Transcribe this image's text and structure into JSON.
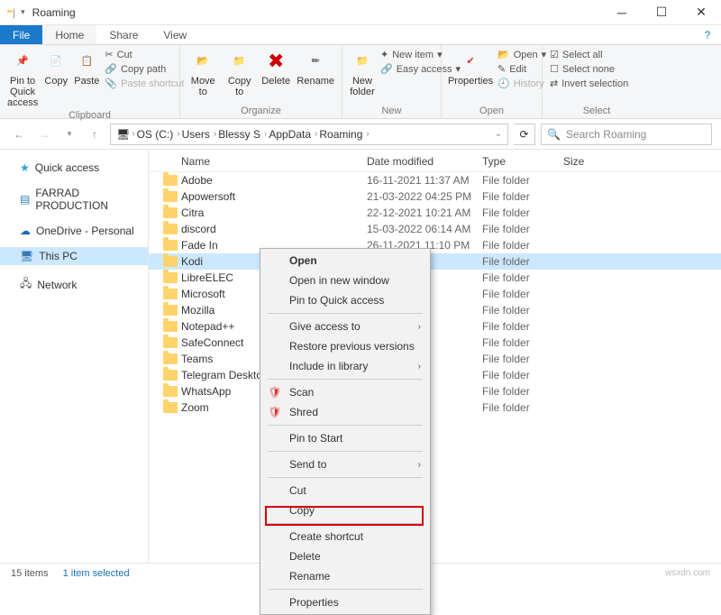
{
  "title": "Roaming",
  "tabs": {
    "file": "File",
    "home": "Home",
    "share": "Share",
    "view": "View"
  },
  "ribbon": {
    "clipboard": {
      "label": "Clipboard",
      "pin": "Pin to Quick access",
      "copy": "Copy",
      "paste": "Paste",
      "cut": "Cut",
      "copypath": "Copy path",
      "pasteshort": "Paste shortcut"
    },
    "organize": {
      "label": "Organize",
      "move": "Move to",
      "copyto": "Copy to",
      "delete": "Delete",
      "rename": "Rename"
    },
    "new": {
      "label": "New",
      "folder": "New folder",
      "newitem": "New item",
      "easy": "Easy access"
    },
    "open": {
      "label": "Open",
      "props": "Properties",
      "open": "Open",
      "edit": "Edit",
      "history": "History"
    },
    "select": {
      "label": "Select",
      "all": "Select all",
      "none": "Select none",
      "invert": "Invert selection"
    }
  },
  "breadcrumb": [
    "OS (C:)",
    "Users",
    "Blessy S",
    "AppData",
    "Roaming"
  ],
  "search_placeholder": "Search Roaming",
  "sidebar": [
    {
      "label": "Quick access",
      "color": "#3a9adb"
    },
    {
      "label": "FARRAD PRODUCTION",
      "color": "#2f7fbf"
    },
    {
      "label": "OneDrive - Personal",
      "color": "#0b68c1"
    },
    {
      "label": "This PC",
      "color": "#3a7ab5",
      "selected": true
    },
    {
      "label": "Network",
      "color": "#555"
    }
  ],
  "columns": {
    "name": "Name",
    "date": "Date modified",
    "type": "Type",
    "size": "Size"
  },
  "files": [
    {
      "name": "Adobe",
      "date": "16-11-2021 11:37 AM",
      "type": "File folder"
    },
    {
      "name": "Apowersoft",
      "date": "21-03-2022 04:25 PM",
      "type": "File folder"
    },
    {
      "name": "Citra",
      "date": "22-12-2021 10:21 AM",
      "type": "File folder"
    },
    {
      "name": "discord",
      "date": "15-03-2022 06:14 AM",
      "type": "File folder"
    },
    {
      "name": "Fade In",
      "date": "26-11-2021 11:10 PM",
      "type": "File folder"
    },
    {
      "name": "Kodi",
      "date": "",
      "type": "File folder",
      "selected": true
    },
    {
      "name": "LibreELEC",
      "date": "",
      "type": "File folder"
    },
    {
      "name": "Microsoft",
      "date": "",
      "type": "File folder"
    },
    {
      "name": "Mozilla",
      "date": "",
      "type": "File folder"
    },
    {
      "name": "Notepad++",
      "date": "",
      "type": "File folder"
    },
    {
      "name": "SafeConnect",
      "date": "",
      "type": "File folder"
    },
    {
      "name": "Teams",
      "date": "",
      "type": "File folder"
    },
    {
      "name": "Telegram Desktop",
      "date": "",
      "type": "File folder"
    },
    {
      "name": "WhatsApp",
      "date": "",
      "type": "File folder"
    },
    {
      "name": "Zoom",
      "date": "",
      "type": "File folder"
    }
  ],
  "context": {
    "open": "Open",
    "open_new": "Open in new window",
    "pin_quick": "Pin to Quick access",
    "give_access": "Give access to",
    "restore": "Restore previous versions",
    "include": "Include in library",
    "scan": "Scan",
    "shred": "Shred",
    "pin_start": "Pin to Start",
    "send_to": "Send to",
    "cut": "Cut",
    "copy": "Copy",
    "shortcut": "Create shortcut",
    "delete": "Delete",
    "rename": "Rename",
    "properties": "Properties"
  },
  "status": {
    "items": "15 items",
    "selected": "1 item selected"
  },
  "watermark": "wsxdn.com"
}
